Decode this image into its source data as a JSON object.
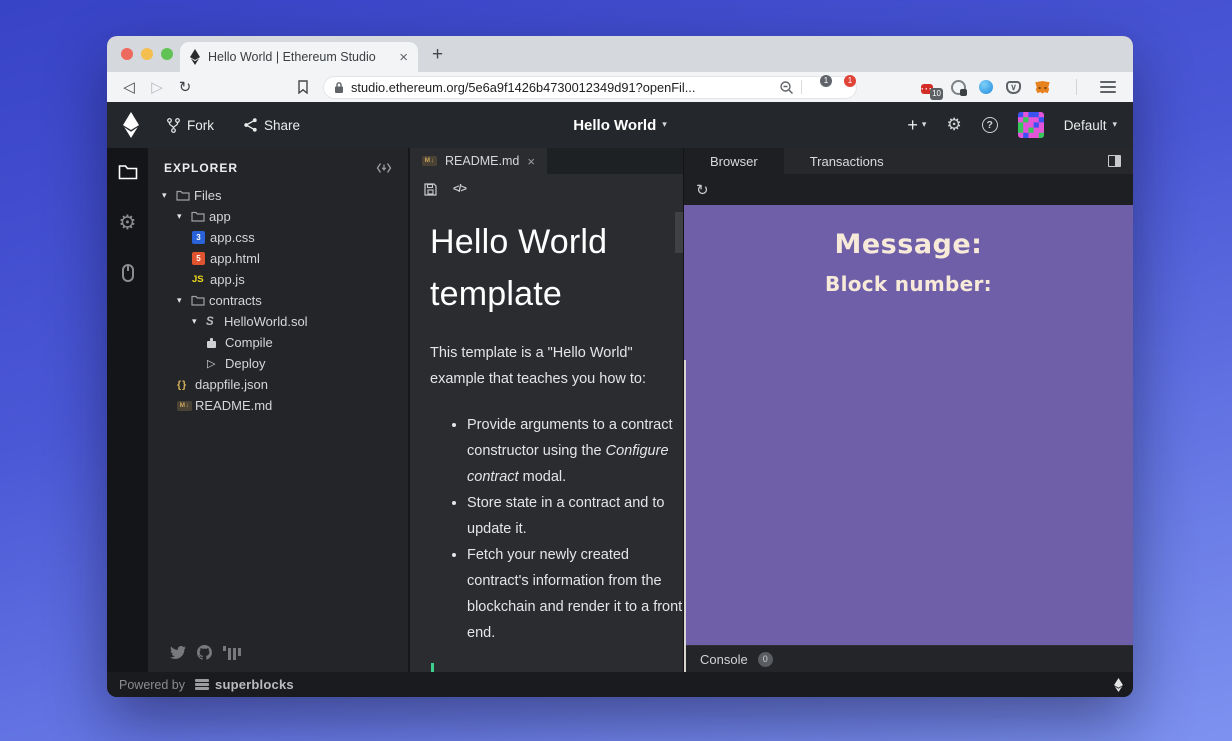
{
  "browser": {
    "tab_title": "Hello World | Ethereum Studio",
    "url": "studio.ethereum.org/5e6a9f1426b4730012349d91?openFil...",
    "badges": {
      "brave": "1",
      "triangle": "1",
      "lastpass": "10"
    }
  },
  "header": {
    "fork_label": "Fork",
    "share_label": "Share",
    "project_title": "Hello World",
    "network_label": "Default"
  },
  "explorer": {
    "title": "EXPLORER",
    "items": [
      {
        "depth": 0,
        "caret": true,
        "icon": "folder",
        "label": "Files"
      },
      {
        "depth": 1,
        "caret": true,
        "icon": "folder",
        "label": "app"
      },
      {
        "depth": 2,
        "caret": false,
        "icon": "css",
        "label": "app.css"
      },
      {
        "depth": 2,
        "caret": false,
        "icon": "html",
        "label": "app.html"
      },
      {
        "depth": 2,
        "caret": false,
        "icon": "js",
        "label": "app.js"
      },
      {
        "depth": 1,
        "caret": true,
        "icon": "folder",
        "label": "contracts"
      },
      {
        "depth": 2,
        "caret": true,
        "icon": "solidity",
        "label": "HelloWorld.sol"
      },
      {
        "depth": 3,
        "caret": false,
        "icon": "compile",
        "label": "Compile"
      },
      {
        "depth": 3,
        "caret": false,
        "icon": "deploy",
        "label": "Deploy"
      },
      {
        "depth": 1,
        "caret": false,
        "icon": "json",
        "label": "dappfile.json"
      },
      {
        "depth": 1,
        "caret": false,
        "icon": "markdown",
        "label": "README.md"
      }
    ]
  },
  "editor": {
    "tab_label": "README.md",
    "heading": "Hello World template",
    "intro": "This template is a \"Hello World\" example that teaches you how to:",
    "bullets": [
      [
        {
          "text": "Provide arguments to a contract constructor using the "
        },
        {
          "text": "Configure contract",
          "italic": true
        },
        {
          "text": " modal."
        }
      ],
      [
        {
          "text": "Store state in a contract and to update it."
        }
      ],
      [
        {
          "text": "Fetch your newly created contract's information from the blockchain and render it to a front end."
        }
      ]
    ]
  },
  "preview": {
    "tabs": [
      {
        "label": "Browser",
        "active": true
      },
      {
        "label": "Transactions",
        "active": false
      }
    ],
    "message_label": "Message:",
    "block_label": "Block number:",
    "console_label": "Console",
    "console_count": "0"
  },
  "footer": {
    "powered_by": "Powered by",
    "brand": "superblocks"
  },
  "colors": {
    "preview_background": "#6f5fa9",
    "preview_text": "#f7ead9",
    "header_background": "#24272c",
    "accent_green": "#3ecf8e"
  }
}
